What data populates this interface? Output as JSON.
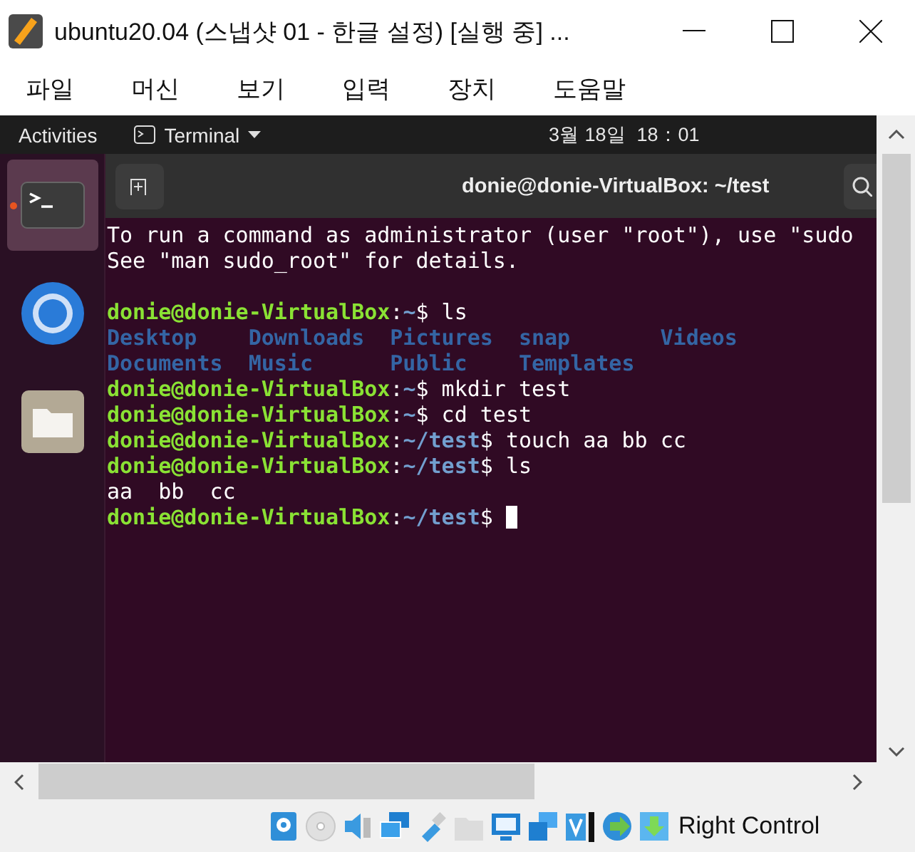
{
  "window": {
    "title": "ubuntu20.04 (스냅샷 01 - 한글 설정) [실행 중] ..."
  },
  "menu": [
    "파일",
    "머신",
    "보기",
    "입력",
    "장치",
    "도움말"
  ],
  "guest_top_bar": {
    "activities": "Activities",
    "app": "Terminal",
    "clock": "3월 18일  18：01"
  },
  "dock": [
    {
      "kind": "terminal",
      "selected": true
    },
    {
      "kind": "browser",
      "selected": false
    },
    {
      "kind": "files",
      "selected": false
    }
  ],
  "terminal": {
    "title": "donie@donie-VirtualBox: ~/test",
    "lines": [
      {
        "kind": "text",
        "segments": [
          {
            "kind": "plain",
            "text": "To run a command as administrator (user \"root\"), use \"sudo"
          }
        ]
      },
      {
        "kind": "text",
        "segments": [
          {
            "kind": "plain",
            "text": "See \"man sudo_root\" for details."
          }
        ]
      },
      {
        "kind": "blank"
      },
      {
        "kind": "text",
        "segments": [
          {
            "kind": "user",
            "text": "donie@donie-VirtualBox"
          },
          {
            "kind": "plain",
            "text": ":"
          },
          {
            "kind": "path",
            "text": "~"
          },
          {
            "kind": "plain",
            "text": "$ ls"
          }
        ]
      },
      {
        "kind": "listing",
        "items": [
          "Desktop",
          "Downloads",
          "Pictures",
          "snap",
          "Videos"
        ]
      },
      {
        "kind": "listing",
        "items": [
          "Documents",
          "Music",
          "Public",
          "Templates"
        ]
      },
      {
        "kind": "text",
        "segments": [
          {
            "kind": "user",
            "text": "donie@donie-VirtualBox"
          },
          {
            "kind": "plain",
            "text": ":"
          },
          {
            "kind": "path",
            "text": "~"
          },
          {
            "kind": "plain",
            "text": "$ mkdir test"
          }
        ]
      },
      {
        "kind": "text",
        "segments": [
          {
            "kind": "user",
            "text": "donie@donie-VirtualBox"
          },
          {
            "kind": "plain",
            "text": ":"
          },
          {
            "kind": "path",
            "text": "~"
          },
          {
            "kind": "plain",
            "text": "$ cd test"
          }
        ]
      },
      {
        "kind": "text",
        "segments": [
          {
            "kind": "user",
            "text": "donie@donie-VirtualBox"
          },
          {
            "kind": "plain",
            "text": ":"
          },
          {
            "kind": "path",
            "text": "~/test"
          },
          {
            "kind": "plain",
            "text": "$ touch aa bb cc"
          }
        ]
      },
      {
        "kind": "text",
        "segments": [
          {
            "kind": "user",
            "text": "donie@donie-VirtualBox"
          },
          {
            "kind": "plain",
            "text": ":"
          },
          {
            "kind": "path",
            "text": "~/test"
          },
          {
            "kind": "plain",
            "text": "$ ls"
          }
        ]
      },
      {
        "kind": "text",
        "segments": [
          {
            "kind": "plain",
            "text": "aa  bb  cc"
          }
        ]
      },
      {
        "kind": "text",
        "segments": [
          {
            "kind": "user",
            "text": "donie@donie-VirtualBox"
          },
          {
            "kind": "plain",
            "text": ":"
          },
          {
            "kind": "path",
            "text": "~/test"
          },
          {
            "kind": "plain",
            "text": "$"
          },
          {
            "kind": "cursor"
          }
        ]
      }
    ]
  },
  "status_bar": {
    "host_key": "Right Control"
  }
}
